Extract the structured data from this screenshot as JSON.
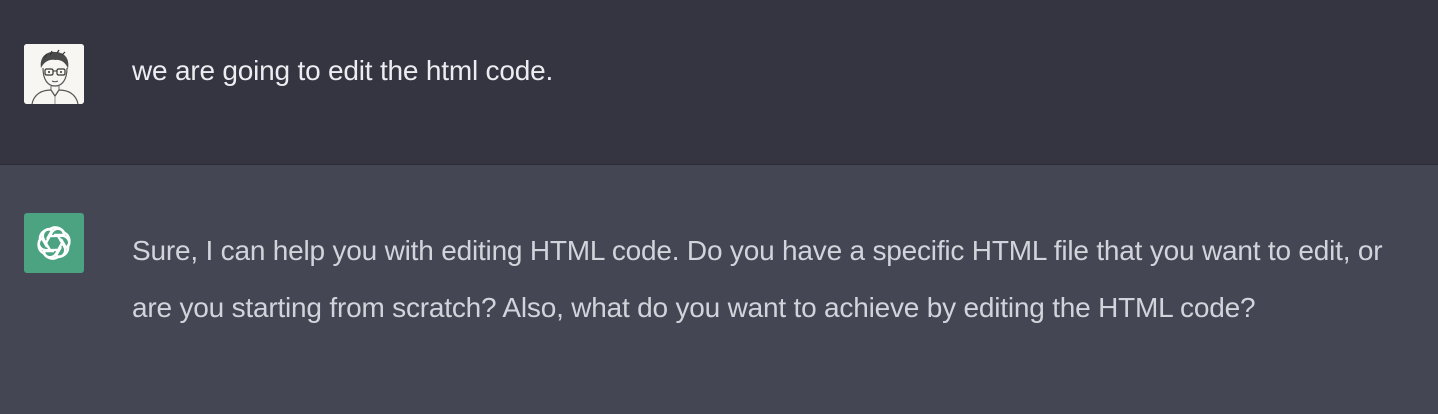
{
  "messages": {
    "user": {
      "avatar_icon": "user-sketch-portrait-icon",
      "text": "we are going to edit the html code."
    },
    "assistant": {
      "avatar_icon": "openai-logo-icon",
      "avatar_color": "#4ba382",
      "text": "Sure, I can help you with editing HTML code. Do you have a specific HTML file that you want to edit, or are you starting from scratch? Also, what do you want to achieve by editing the HTML code?"
    }
  },
  "colors": {
    "user_background": "#343541",
    "assistant_background": "#444654",
    "text_color": "#ececf1"
  }
}
